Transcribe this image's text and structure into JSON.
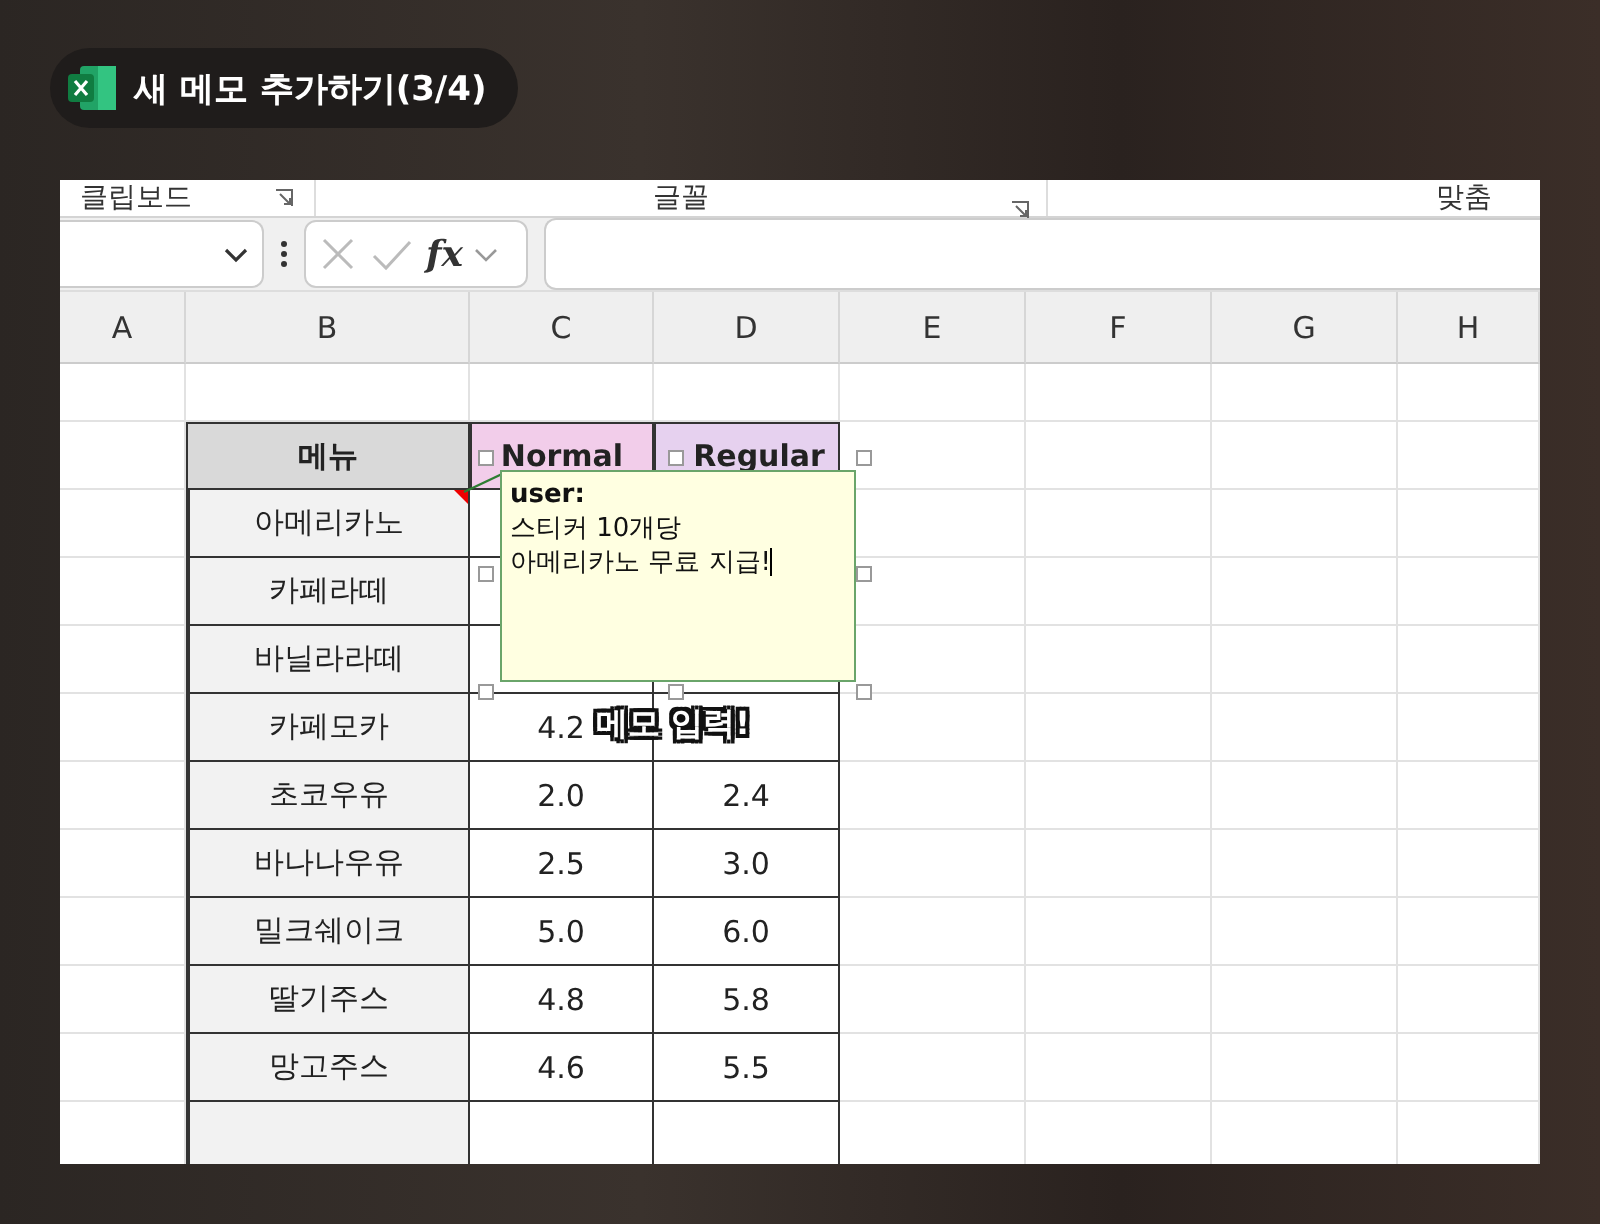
{
  "title_badge": {
    "text": "새 메모 추가하기(3/4)"
  },
  "ribbon_groups": [
    {
      "label": "클립보드",
      "has_launcher": true
    },
    {
      "label": "글꼴",
      "has_launcher": true
    },
    {
      "label": "맞춤",
      "has_launcher": false
    }
  ],
  "formula_bar": {
    "function_label": "fx"
  },
  "column_headers": [
    "A",
    "B",
    "C",
    "D",
    "E",
    "F",
    "G",
    "H"
  ],
  "table": {
    "header": [
      "메뉴",
      "Normal",
      "Regular"
    ],
    "rows": [
      {
        "menu": "아메리카노",
        "has_comment": true
      },
      {
        "menu": "카페라떼",
        "has_comment": false
      },
      {
        "menu": "바닐라라떼",
        "has_comment": false
      },
      {
        "menu": "카페모카",
        "normal": "4.2",
        "has_comment": false
      },
      {
        "menu": "초코우유",
        "normal": "2.0",
        "regular": "2.4",
        "has_comment": false
      },
      {
        "menu": "바나나우유",
        "normal": "2.5",
        "regular": "3.0",
        "has_comment": false
      },
      {
        "menu": "밀크쉐이크",
        "normal": "5.0",
        "regular": "6.0",
        "has_comment": false
      },
      {
        "menu": "딸기주스",
        "normal": "4.8",
        "regular": "5.8",
        "has_comment": false
      },
      {
        "menu": "망고주스",
        "normal": "4.6",
        "regular": "5.5",
        "has_comment": false
      }
    ]
  },
  "comment_note": {
    "author": "user:",
    "lines": [
      "스티커 10개당",
      "아메리카노 무료 지급!"
    ]
  },
  "caption": "메모 입력!"
}
